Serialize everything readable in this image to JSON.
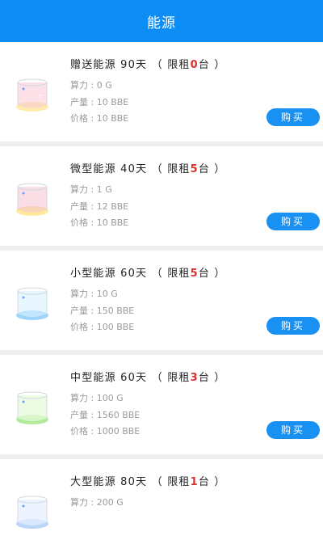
{
  "header": {
    "title": "能源"
  },
  "colors": {
    "primary": "#0e8df5",
    "limit_highlight": "#e0302c"
  },
  "products": [
    {
      "icon": "energy-jar-icon",
      "name": "赠送能源",
      "days": "90天",
      "limit_open": "（ 限租",
      "limit_count": "0",
      "limit_close": "台 ）",
      "hashrate": "算力 : 0 G",
      "output": "产量 : 10 BBE",
      "price": "价格 : 10 BBE",
      "buy_label": "购买",
      "liquid_color": "#f7c8d4",
      "base_color": "#ffe48a"
    },
    {
      "icon": "energy-jar-icon",
      "name": "微型能源",
      "days": "40天",
      "limit_open": "（ 限租",
      "limit_count": "5",
      "limit_close": "台 ）",
      "hashrate": "算力 : 1 G",
      "output": "产量 : 12 BBE",
      "price": "价格 : 10 BBE",
      "buy_label": "购买",
      "liquid_color": "#f5c2cf",
      "base_color": "#ffe27a"
    },
    {
      "icon": "energy-jar-icon",
      "name": "小型能源",
      "days": "60天",
      "limit_open": "（ 限租",
      "limit_count": "5",
      "limit_close": "台 ）",
      "hashrate": "算力 : 10 G",
      "output": "产量 : 150 BBE",
      "price": "价格 : 100 BBE",
      "buy_label": "购买",
      "liquid_color": "#d8f2ff",
      "base_color": "#7cc5f7"
    },
    {
      "icon": "energy-jar-icon",
      "name": "中型能源",
      "days": "60天",
      "limit_open": "（ 限租",
      "limit_count": "3",
      "limit_close": "台 ）",
      "hashrate": "算力 : 100 G",
      "output": "产量 : 1560 BBE",
      "price": "价格 : 1000 BBE",
      "buy_label": "购买",
      "liquid_color": "#e6f9da",
      "base_color": "#9be37a"
    },
    {
      "icon": "energy-jar-icon",
      "name": "大型能源",
      "days": "80天",
      "limit_open": "（ 限租",
      "limit_count": "1",
      "limit_close": "台 ）",
      "hashrate": "算力 : 200 G",
      "output": "",
      "price": "",
      "buy_label": "",
      "liquid_color": "#e6f0ff",
      "base_color": "#8fb8f5"
    }
  ]
}
